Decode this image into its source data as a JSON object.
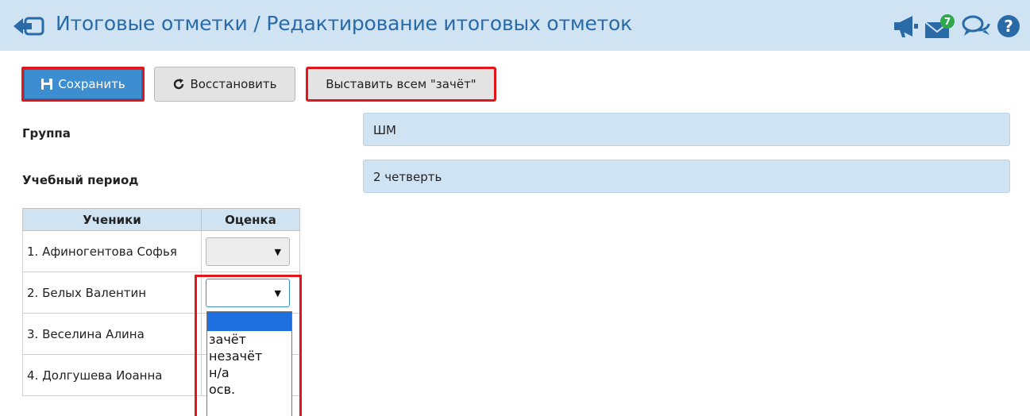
{
  "header": {
    "title": "Итоговые отметки / Редактирование итоговых отметок",
    "notification_count": "7",
    "icons": [
      "back-icon",
      "megaphone-icon",
      "mail-icon",
      "chat-icon",
      "help-icon"
    ],
    "background": "#cfe3f3",
    "title_color": "#2a6aa7"
  },
  "toolbar": {
    "save_label": "Сохранить",
    "restore_label": "Восстановить",
    "set_all_label": "Выставить всем \"зачёт\""
  },
  "form": {
    "group_label": "Группа",
    "group_value": "ШМ",
    "period_label": "Учебный период",
    "period_value": "2 четверть"
  },
  "table": {
    "columns": [
      "Ученики",
      "Оценка"
    ],
    "rows": [
      {
        "student": "1. Афиногентова Софья",
        "grade": ""
      },
      {
        "student": "2. Белых Валентин",
        "grade": ""
      },
      {
        "student": "3. Веселина Алина",
        "grade": ""
      },
      {
        "student": "4. Долгушева Иоанна",
        "grade": ""
      }
    ]
  },
  "dropdown": {
    "options": [
      "",
      "зачёт",
      "незачёт",
      "н/а",
      "осв."
    ],
    "highlight_color": "#1e6fe0"
  },
  "colors": {
    "accent": "#3d8ed0",
    "highlight_border": "#e4141b",
    "badge": "#2ea84a"
  }
}
